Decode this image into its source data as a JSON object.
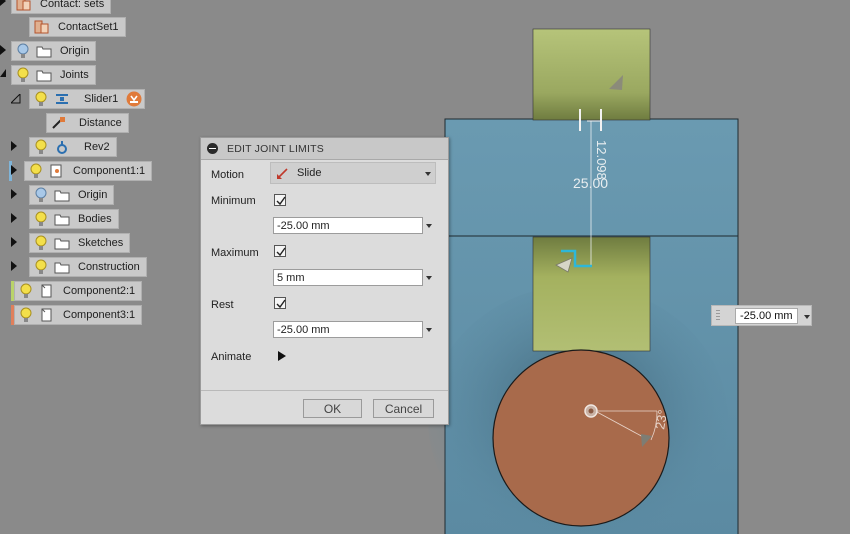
{
  "browser": {
    "items": [
      {
        "label": "Contact: sets",
        "icon": "contact-sets-icon"
      },
      {
        "label": "ContactSet1",
        "icon": "contact-set-icon"
      },
      {
        "label": "Origin",
        "icon": "folder-icon"
      },
      {
        "label": "Joints",
        "icon": "folder-icon"
      },
      {
        "label": "Slider1",
        "icon": "slider-joint-icon",
        "badge": "joint-warning-icon"
      },
      {
        "label": "Distance",
        "icon": "distance-icon"
      },
      {
        "label": "Rev2",
        "icon": "revolute-joint-icon"
      },
      {
        "label": "Component1:1",
        "icon": "component-icon",
        "color": "#7fb4d8"
      },
      {
        "label": "Origin",
        "icon": "folder-icon"
      },
      {
        "label": "Bodies",
        "icon": "folder-icon"
      },
      {
        "label": "Sketches",
        "icon": "folder-icon"
      },
      {
        "label": "Construction",
        "icon": "folder-icon"
      },
      {
        "label": "Component2:1",
        "icon": "component-icon",
        "color": "#b9d36a"
      },
      {
        "label": "Component3:1",
        "icon": "component-icon",
        "color": "#e07f5b"
      }
    ]
  },
  "dialog": {
    "title": "EDIT JOINT LIMITS",
    "motion_label": "Motion",
    "motion_value": "Slide",
    "minimum_label": "Minimum",
    "minimum_checked": true,
    "minimum_value": "-25.00 mm",
    "maximum_label": "Maximum",
    "maximum_checked": true,
    "maximum_value": "5 mm",
    "rest_label": "Rest",
    "rest_checked": true,
    "rest_value": "-25.00 mm",
    "animate_label": "Animate",
    "ok_label": "OK",
    "cancel_label": "Cancel"
  },
  "viewport": {
    "dim_vertical": "12.098",
    "dim_length": "25.00",
    "angle_label": "23°",
    "floating_input_value": "-25.00 mm",
    "colors": {
      "background": "#8a8a8a",
      "blue_plate": "#5e8ea6",
      "green_slider": "#a4b15f",
      "copper_disk": "#a86a4b",
      "dimension_cyan": "#2eb7d8"
    }
  }
}
